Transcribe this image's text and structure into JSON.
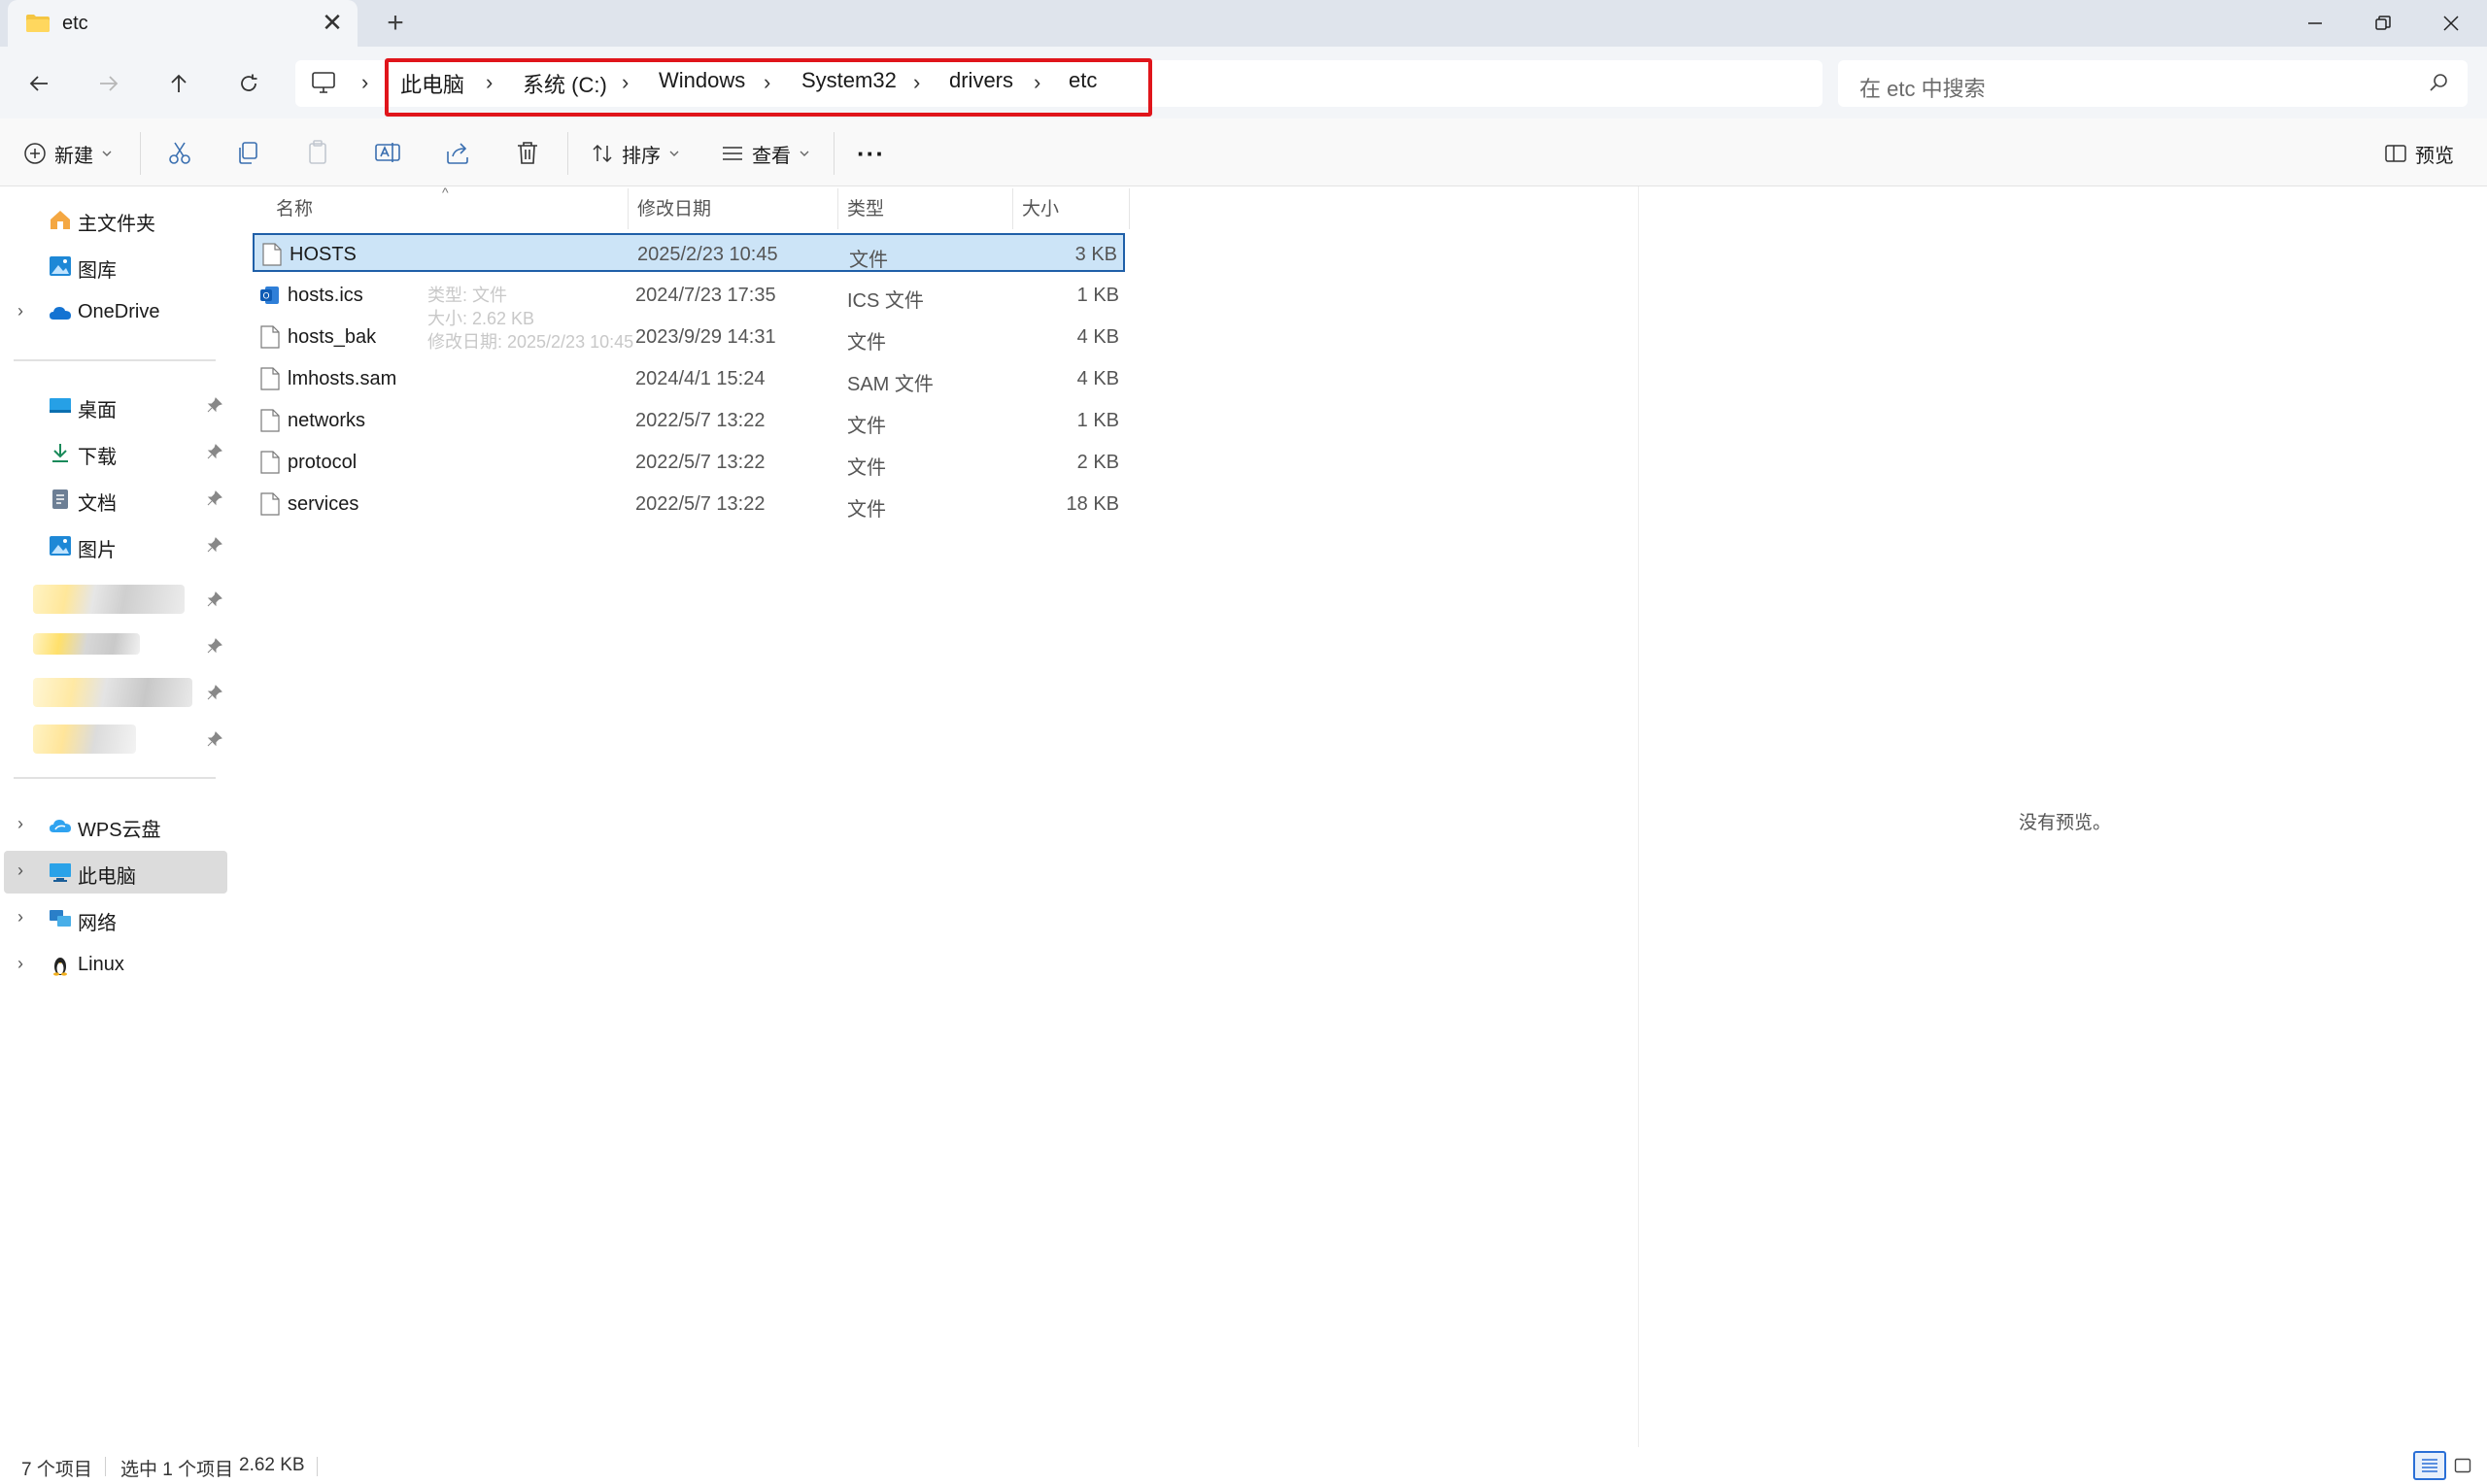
{
  "window": {
    "tab_title": "etc",
    "close_tab_glyph": "✕",
    "new_tab_glyph": "+"
  },
  "nav": {
    "back_icon": "arrow-left",
    "forward_icon": "arrow-right",
    "up_icon": "arrow-up",
    "refresh_icon": "refresh"
  },
  "breadcrumb": {
    "items": [
      "此电脑",
      "系统 (C:)",
      "Windows",
      "System32",
      "drivers",
      "etc"
    ]
  },
  "search": {
    "placeholder": "在 etc 中搜索"
  },
  "toolbar": {
    "new_label": "新建",
    "sort_label": "排序",
    "view_label": "查看",
    "more_label": "···",
    "preview_label": "预览"
  },
  "sidebar": {
    "items": [
      {
        "label": "主文件夹"
      },
      {
        "label": "图库"
      },
      {
        "label": "OneDrive"
      },
      {
        "label": "桌面"
      },
      {
        "label": "下载"
      },
      {
        "label": "文档"
      },
      {
        "label": "图片"
      },
      {
        "label": "WPS云盘"
      },
      {
        "label": "此电脑"
      },
      {
        "label": "网络"
      },
      {
        "label": "Linux"
      }
    ]
  },
  "columns": {
    "name": "名称",
    "date": "修改日期",
    "type": "类型",
    "size": "大小"
  },
  "files": [
    {
      "name": "HOSTS",
      "date": "2025/2/23 10:45",
      "type": "文件",
      "size": "3 KB"
    },
    {
      "name": "hosts.ics",
      "date": "2024/7/23 17:35",
      "type": "ICS 文件",
      "size": "1 KB"
    },
    {
      "name": "hosts_bak",
      "date": "2023/9/29 14:31",
      "type": "文件",
      "size": "4 KB"
    },
    {
      "name": "lmhosts.sam",
      "date": "2024/4/1 15:24",
      "type": "SAM 文件",
      "size": "4 KB"
    },
    {
      "name": "networks",
      "date": "2022/5/7 13:22",
      "type": "文件",
      "size": "1 KB"
    },
    {
      "name": "protocol",
      "date": "2022/5/7 13:22",
      "type": "文件",
      "size": "2 KB"
    },
    {
      "name": "services",
      "date": "2022/5/7 13:22",
      "type": "文件",
      "size": "18 KB"
    }
  ],
  "tooltip": {
    "line1": "类型: 文件",
    "line2": "大小: 2.62 KB",
    "line3": "修改日期: 2025/2/23 10:45"
  },
  "preview": {
    "empty_text": "没有预览。"
  },
  "status": {
    "count": "7 个项目",
    "selection": "选中 1 个项目",
    "selection_size": "2.62 KB"
  },
  "colors": {
    "highlight_box": "#e0151b",
    "selection_bg": "#cce4f7",
    "selection_border": "#1f5fa8"
  }
}
